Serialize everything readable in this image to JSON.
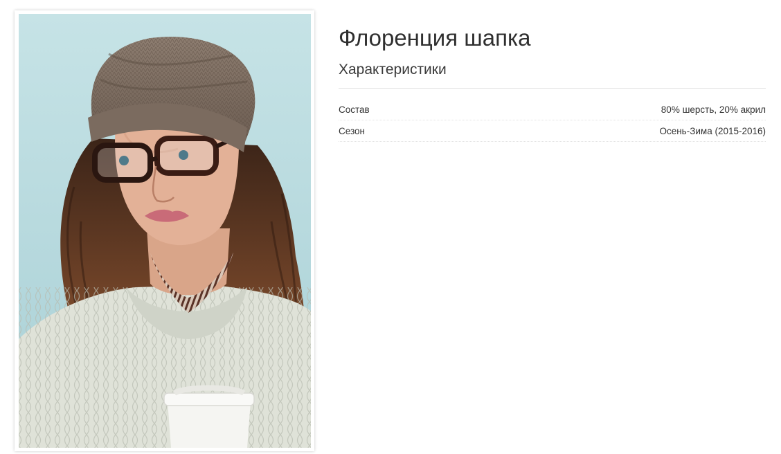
{
  "product": {
    "title": "Флоренция шапка",
    "photo_alt": "Флоренция шапка"
  },
  "characteristics": {
    "heading": "Характеристики",
    "rows": [
      {
        "label": "Состав",
        "value": "80% шерсть, 20% акрил"
      },
      {
        "label": "Сезон",
        "value": "Осень-Зима (2015-2016)"
      }
    ]
  },
  "colors": {
    "background": "#ffffff",
    "photo_backdrop": "#bfe0e3",
    "text": "#333333",
    "divider": "#e2e2e2"
  }
}
